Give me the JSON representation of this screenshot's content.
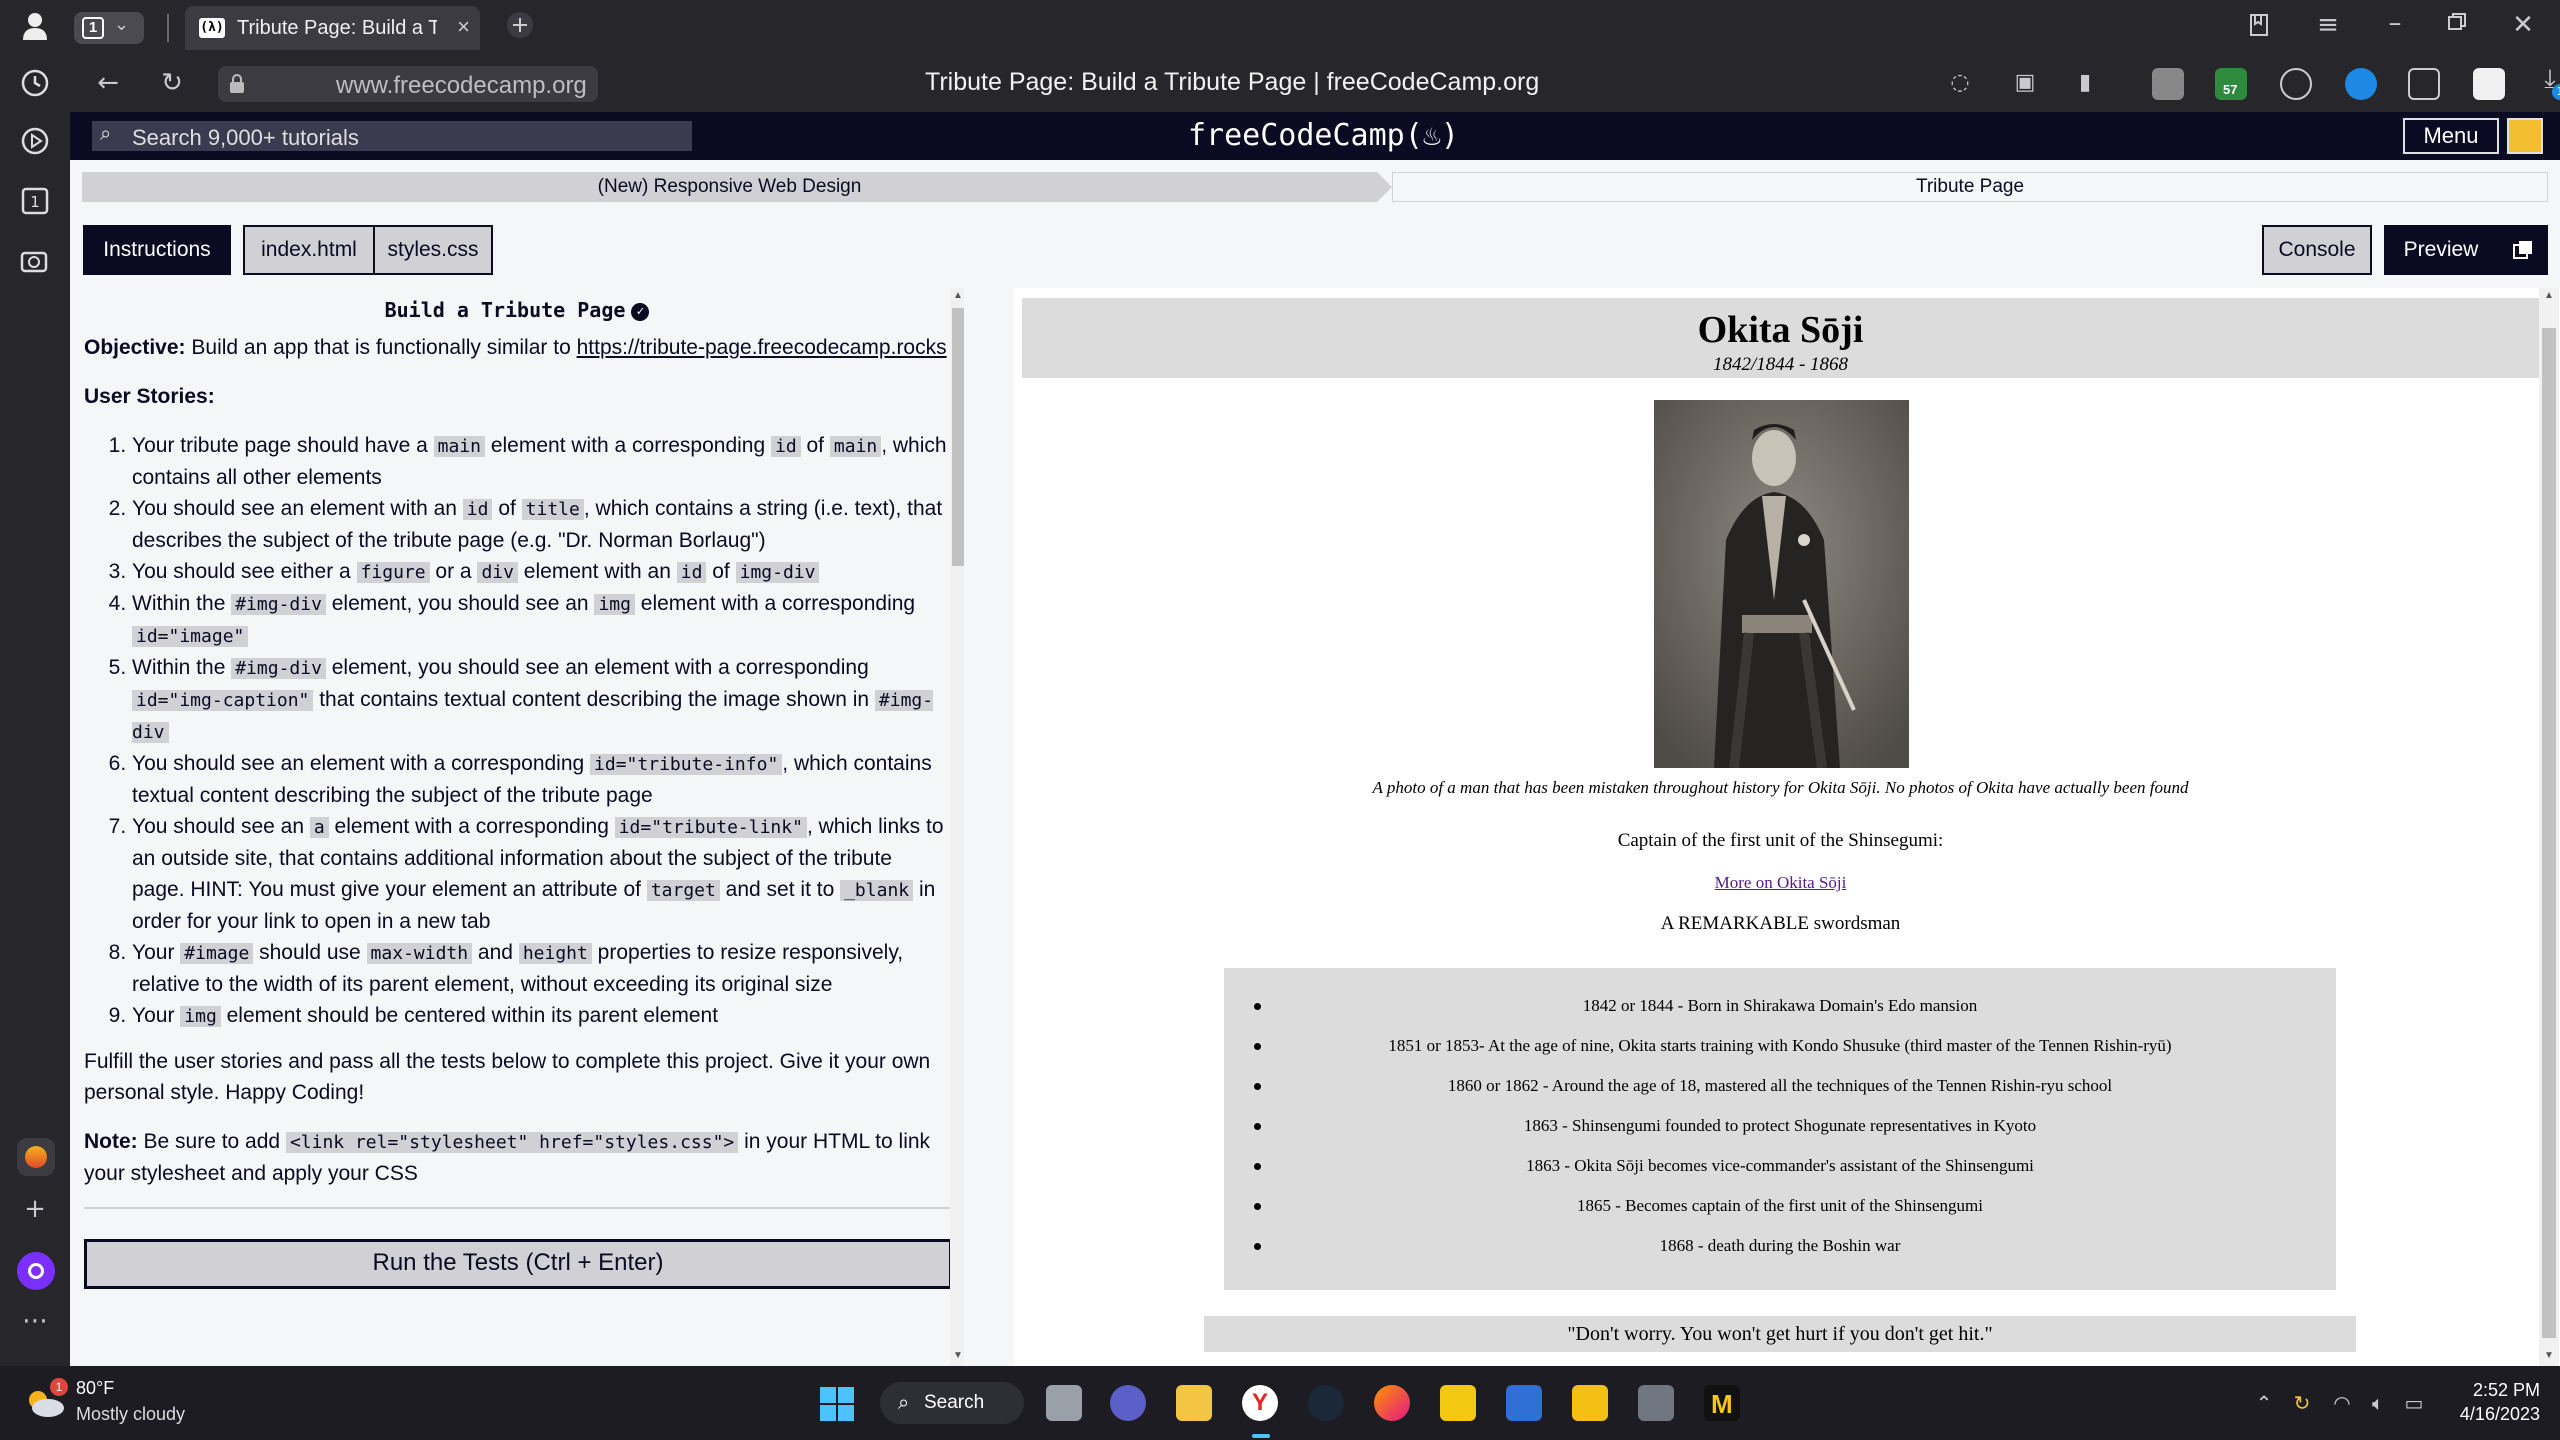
{
  "browser": {
    "tab_count": "1",
    "tab_title": "Tribute Page: Build a Tril",
    "tab_close": "×",
    "url": "www.freecodecamp.org",
    "page_title": "Tribute Page: Build a Tribute Page | freeCodeCamp.org",
    "ext_badge_shield": "57",
    "download_badge": "1"
  },
  "fcc_nav": {
    "search_placeholder": "Search 9,000+ tutorials",
    "logo": "freeCodeCamp(🔥)",
    "menu_label": "Menu"
  },
  "breadcrumb": {
    "course": "(New) Responsive Web Design",
    "project": "Tribute Page"
  },
  "tabs": {
    "instructions": "Instructions",
    "index_html": "index.html",
    "styles_css": "styles.css",
    "console": "Console",
    "preview": "Preview"
  },
  "instructions": {
    "title": "Build a Tribute Page",
    "objective_label": "Objective:",
    "objective_text": " Build an app that is functionally similar to ",
    "objective_link": "https://tribute-page.freecodecamp.rocks",
    "user_stories_heading": "User Stories:",
    "fulfill_text": "Fulfill the user stories and pass all the tests below to complete this project. Give it your own personal style. Happy Coding!",
    "note_label": "Note:",
    "note_pre": " Be sure to add ",
    "note_code": "<link rel=\"stylesheet\" href=\"styles.css\">",
    "note_post": " in your HTML to link your stylesheet and apply your CSS",
    "run_button": "Run the Tests (Ctrl + Enter)",
    "stories": [
      {
        "t1": "Your tribute page should have a ",
        "c1": "main",
        "t2": " element with a corresponding ",
        "c2": "id",
        "t3": " of ",
        "c3": "main",
        "t4": ", which contains all other elements"
      },
      {
        "t1": "You should see an element with an ",
        "c1": "id",
        "t2": " of ",
        "c2": "title",
        "t3": ", which contains a string (i.e. text), that describes the subject of the tribute page (e.g. \"Dr. Norman Borlaug\")",
        "c3": "",
        "t4": ""
      },
      {
        "t1": "You should see either a ",
        "c1": "figure",
        "t2": " or a ",
        "c2": "div",
        "t3": " element with an ",
        "c3": "id",
        "t4": " of ",
        "c4": "img-div"
      },
      {
        "t1": "Within the ",
        "c1": "#img-div",
        "t2": " element, you should see an ",
        "c2": "img",
        "t3": " element with a corresponding ",
        "c3": "id=\"image\"",
        "t4": ""
      },
      {
        "t1": "Within the ",
        "c1": "#img-div",
        "t2": " element, you should see an element with a corresponding ",
        "c2": "id=\"img-caption\"",
        "t3": " that contains textual content describing the image shown in ",
        "c3": "#img-div",
        "t4": ""
      },
      {
        "t1": "You should see an element with a corresponding ",
        "c1": "id=\"tribute-info\"",
        "t2": ", which contains textual content describing the subject of the tribute page",
        "c2": "",
        "t3": "",
        "c3": "",
        "t4": ""
      },
      {
        "t1": "You should see an ",
        "c1": "a",
        "t2": " element with a corresponding ",
        "c2": "id=\"tribute-link\"",
        "t3": ", which links to an outside site, that contains additional information about the subject of the tribute page. HINT: You must give your element an attribute of ",
        "c3": "target",
        "t4": " and set it to ",
        "c4": "_blank",
        "t5": " in order for your link to open in a new tab"
      },
      {
        "t1": "Your ",
        "c1": "#image",
        "t2": " should use ",
        "c2": "max-width",
        "t3": " and ",
        "c3": "height",
        "t4": " properties to resize responsively, relative to the width of its parent element, without exceeding its original size"
      },
      {
        "t1": "Your ",
        "c1": "img",
        "t2": " element should be centered within its parent element",
        "c2": "",
        "t3": "",
        "c3": "",
        "t4": ""
      }
    ]
  },
  "tribute": {
    "name": "Okita Sōji",
    "dates": "1842/1844 - 1868",
    "caption": "A photo of a man that has been mistaken throughout history for Okita Sōji. No photos of Okita have actually been found",
    "role": "Captain of the first unit of the Shinsegumi:",
    "link": "More on Okita Sōji",
    "tagline": "A REMARKABLE swordsman",
    "timeline": [
      "1842 or 1844 - Born in Shirakawa Domain's Edo mansion",
      "1851 or 1853- At the age of nine, Okita starts training with Kondo Shusuke (third master of the Tennen Rishin-ryū)",
      "1860 or 1862 - Around the age of 18, mastered all the techniques of the Tennen Rishin-ryu school",
      "1863 - Shinsengumi founded to protect Shogunate representatives in Kyoto",
      "1863 - Okita Sōji becomes vice-commander's assistant of the Shinsengumi",
      "1865 - Becomes captain of the first unit of the Shinsengumi",
      "1868 - death during the Boshin war"
    ],
    "quote": "\"Don't worry. You won't get hurt if you don't get hit.\""
  },
  "taskbar": {
    "weather_badge": "1",
    "temperature": "80°F",
    "weather": "Mostly cloudy",
    "search_label": "Search",
    "time": "2:52 PM",
    "date": "4/16/2023"
  },
  "colors": {
    "fcc_dark": "#0a0a23",
    "fcc_gray": "#d0d0d5",
    "fcc_bg": "#f5f6f7",
    "tribute_gray": "#dcdcdc",
    "link_visited": "#551a8b"
  }
}
